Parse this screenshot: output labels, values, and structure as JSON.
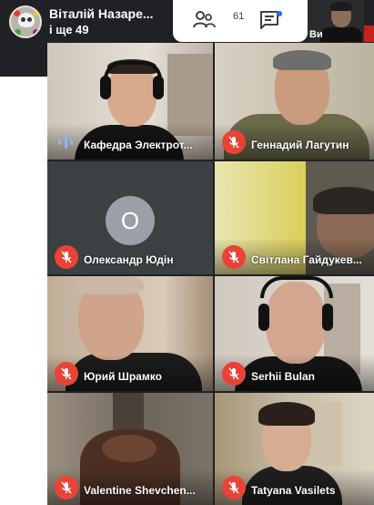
{
  "presenter": {
    "name": "Віталій Назаре...",
    "more": "і ще 49"
  },
  "toolbar": {
    "people_count": "61",
    "people_icon": "people-icon",
    "chat_icon": "chat-icon"
  },
  "self_view": {
    "label": "Ви"
  },
  "participants": [
    {
      "name": "Кафедра Электрот...",
      "state": "speaking"
    },
    {
      "name": "Геннадий Лагутин",
      "state": "muted"
    },
    {
      "name": "Олександр Юдін",
      "state": "muted",
      "avatar_letter": "О"
    },
    {
      "name": "Світлана Гайдукев...",
      "state": "muted"
    },
    {
      "name": "Юрий Шрамко",
      "state": "muted"
    },
    {
      "name": "Serhii Bulan",
      "state": "muted"
    },
    {
      "name": "Valentine Shevchen...",
      "state": "muted"
    },
    {
      "name": "Tatyana Vasilets",
      "state": "muted"
    }
  ],
  "colors": {
    "muted_badge": "#ea4335",
    "speaking_indicator": "#8ab4f8",
    "dark_background": "#202124"
  }
}
